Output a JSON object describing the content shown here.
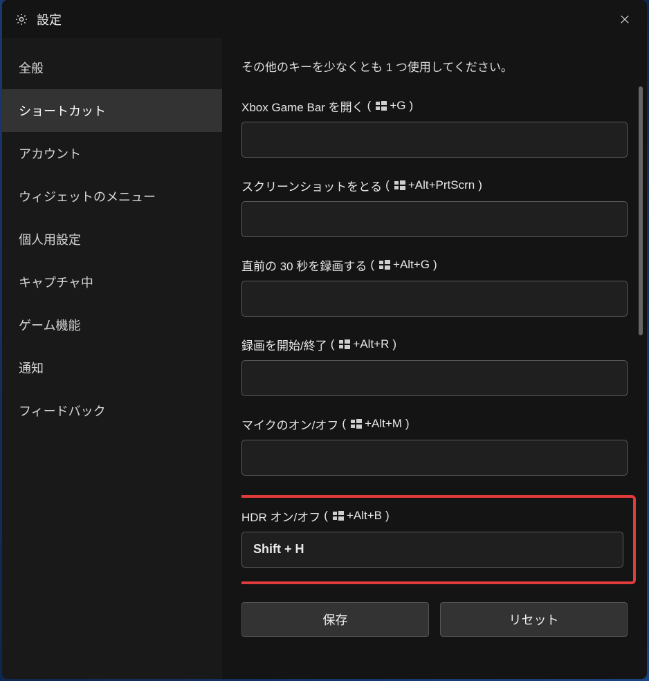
{
  "window": {
    "title": "設定"
  },
  "sidebar": {
    "items": [
      {
        "label": "全般"
      },
      {
        "label": "ショートカット"
      },
      {
        "label": "アカウント"
      },
      {
        "label": "ウィジェットのメニュー"
      },
      {
        "label": "個人用設定"
      },
      {
        "label": "キャプチャ中"
      },
      {
        "label": "ゲーム機能"
      },
      {
        "label": "通知"
      },
      {
        "label": "フィードバック"
      }
    ],
    "active_index": 1
  },
  "content": {
    "intro_line2": "その他のキーを少なくとも 1 つ使用してください。",
    "shortcuts": [
      {
        "label": "Xbox Game Bar を開く",
        "combo_suffix": "+G",
        "value": ""
      },
      {
        "label": "スクリーンショットをとる",
        "combo_suffix": "+Alt+PrtScrn",
        "value": ""
      },
      {
        "label": "直前の 30 秒を録画する",
        "combo_suffix": "+Alt+G",
        "value": ""
      },
      {
        "label": "録画を開始/終了",
        "combo_suffix": "+Alt+R",
        "value": ""
      },
      {
        "label": "マイクのオン/オフ",
        "combo_suffix": "+Alt+M",
        "value": ""
      },
      {
        "label": "HDR オン/オフ",
        "combo_suffix": "+Alt+B",
        "value": "Shift + H",
        "highlighted": true
      }
    ],
    "buttons": {
      "save": "保存",
      "reset": "リセット"
    }
  }
}
